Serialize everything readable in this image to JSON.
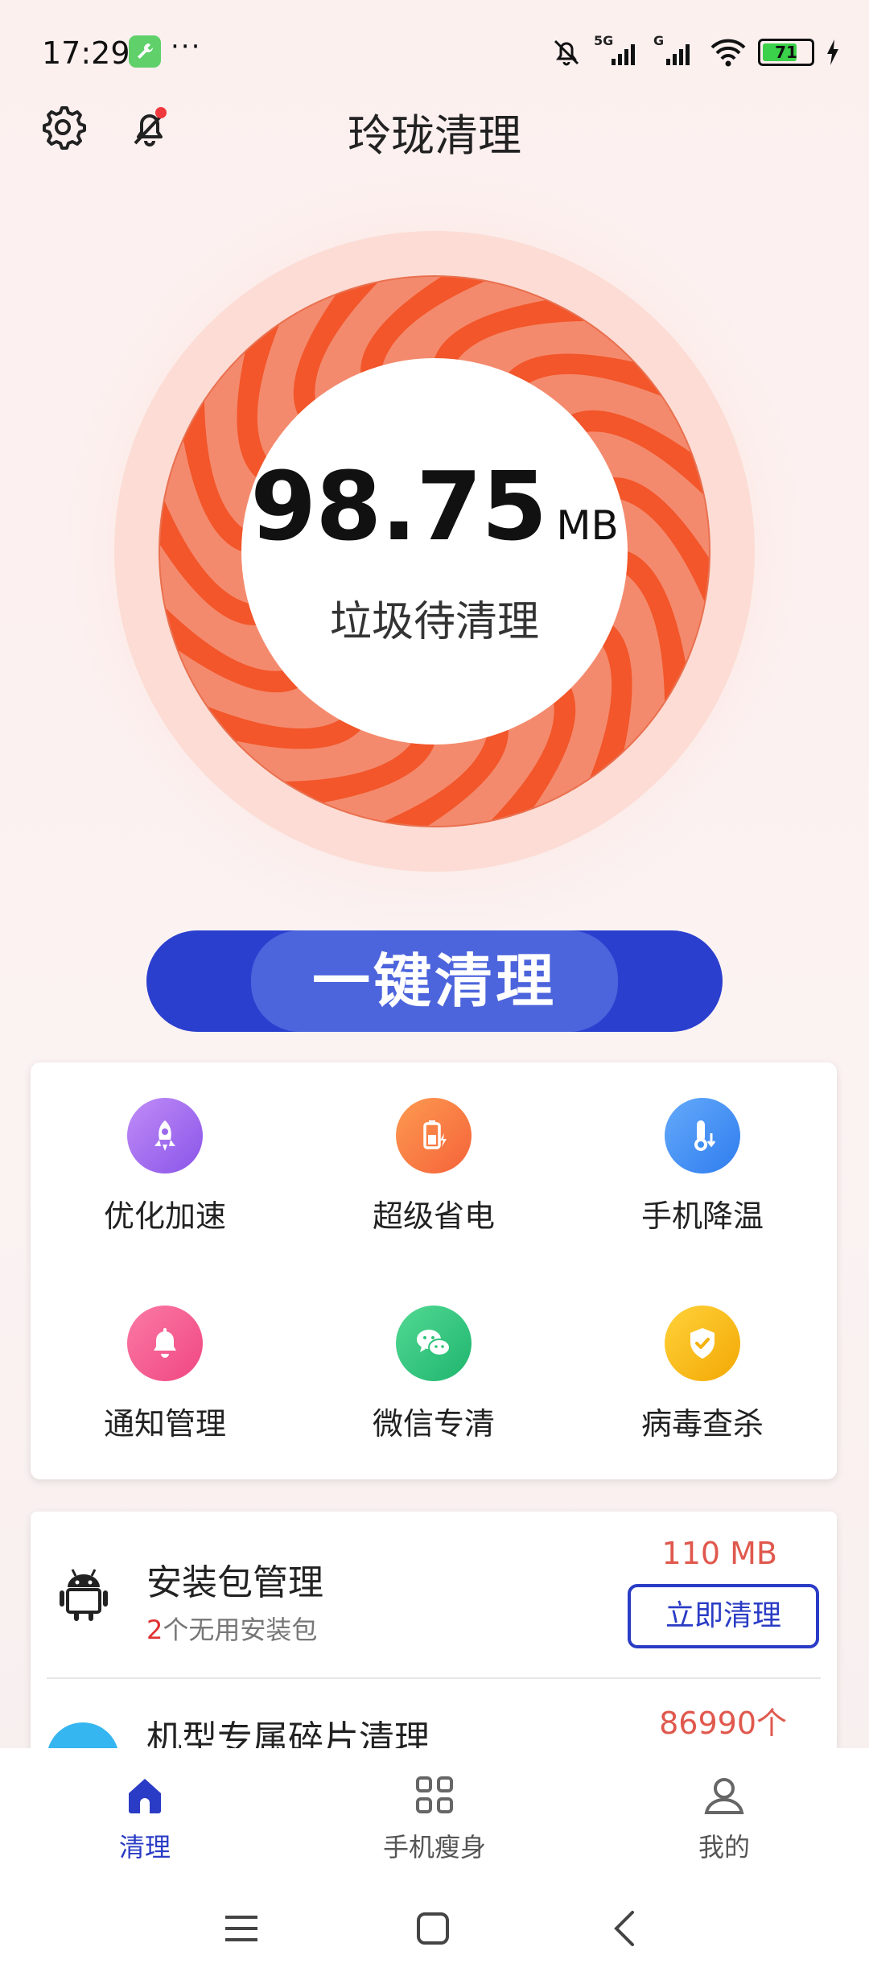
{
  "status_bar": {
    "time": "17:29",
    "dots": "···",
    "battery": "71",
    "network_1": "5G",
    "network_2": "G"
  },
  "header": {
    "title": "玲珑清理",
    "settings_icon": "gear-icon",
    "notification_icon": "bell-muted-icon"
  },
  "gauge": {
    "value": "98.75",
    "unit": "MB",
    "label": "垃圾待清理",
    "colors": {
      "dark": "#f2562a",
      "light": "#f5896a",
      "halo": "#fbd9d0"
    }
  },
  "clean_button": {
    "label": "一键清理",
    "color": "#2b3fcf"
  },
  "tools": [
    {
      "label": "优化加速",
      "icon": "rocket-icon",
      "color": "#a06bf0"
    },
    {
      "label": "超级省电",
      "icon": "battery-saver-icon",
      "color": "#fb7a3c"
    },
    {
      "label": "手机降温",
      "icon": "thermometer-icon",
      "color": "#3d8ff5"
    },
    {
      "label": "通知管理",
      "icon": "bell-icon",
      "color": "#f5558e"
    },
    {
      "label": "微信专清",
      "icon": "wechat-icon",
      "color": "#2ec47b"
    },
    {
      "label": "病毒查杀",
      "icon": "shield-check-icon",
      "color": "#f7b60a"
    }
  ],
  "list": {
    "row1": {
      "title": "安装包管理",
      "count": "2",
      "sub": "个无用安装包",
      "size": "110 MB",
      "button": "立即清理",
      "icon": "android-icon"
    },
    "row2": {
      "title": "机型专属碎片清理",
      "size": "86990个"
    }
  },
  "nav": [
    {
      "label": "清理",
      "icon": "home-icon",
      "active": true
    },
    {
      "label": "手机瘦身",
      "icon": "grid-icon",
      "active": false
    },
    {
      "label": "我的",
      "icon": "user-icon",
      "active": false
    }
  ]
}
